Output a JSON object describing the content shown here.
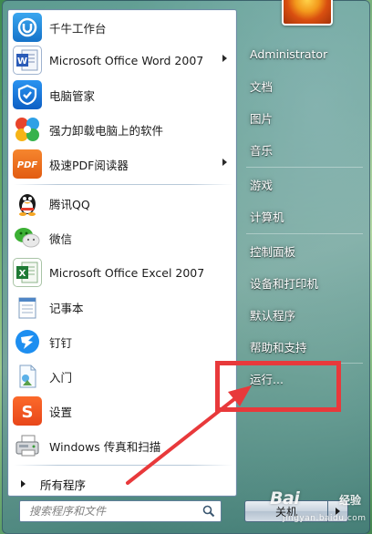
{
  "start_menu": {
    "programs": [
      {
        "id": "qianniu",
        "label": "千牛工作台",
        "icon": "qianniu-icon",
        "has_submenu": false
      },
      {
        "id": "word2007",
        "label": "Microsoft Office Word 2007",
        "icon": "word-icon",
        "has_submenu": true
      },
      {
        "id": "pcmanager",
        "label": "电脑管家",
        "icon": "shield-icon",
        "has_submenu": false
      },
      {
        "id": "uninstaller",
        "label": "强力卸载电脑上的软件",
        "icon": "clover-icon",
        "has_submenu": false
      },
      {
        "id": "pdfreader",
        "label": "极速PDF阅读器",
        "icon": "pdf-icon",
        "has_submenu": true
      },
      {
        "id": "qq",
        "label": "腾讯QQ",
        "icon": "penguin-icon",
        "has_submenu": false
      },
      {
        "id": "wechat",
        "label": "微信",
        "icon": "chat-bubbles-icon",
        "has_submenu": false
      },
      {
        "id": "excel2007",
        "label": "Microsoft Office Excel 2007",
        "icon": "excel-icon",
        "has_submenu": false
      },
      {
        "id": "notepad",
        "label": "记事本",
        "icon": "notepad-icon",
        "has_submenu": false
      },
      {
        "id": "dingtalk",
        "label": "钉钉",
        "icon": "dingtalk-icon",
        "has_submenu": false
      },
      {
        "id": "gettingstarted",
        "label": "入门",
        "icon": "document-icon",
        "has_submenu": false
      },
      {
        "id": "settings",
        "label": "设置",
        "icon": "sogou-icon",
        "has_submenu": false
      },
      {
        "id": "faxscan",
        "label": "Windows 传真和扫描",
        "icon": "fax-icon",
        "has_submenu": false
      }
    ],
    "all_programs_label": "所有程序",
    "search_placeholder": "搜索程序和文件",
    "right_items": [
      {
        "id": "administrator",
        "label": "Administrator"
      },
      {
        "id": "documents",
        "label": "文档"
      },
      {
        "id": "pictures",
        "label": "图片"
      },
      {
        "id": "music",
        "label": "音乐"
      },
      {
        "id": "games",
        "label": "游戏"
      },
      {
        "id": "computer",
        "label": "计算机"
      },
      {
        "id": "controlpanel",
        "label": "控制面板"
      },
      {
        "id": "devices",
        "label": "设备和打印机"
      },
      {
        "id": "defaultprograms",
        "label": "默认程序"
      },
      {
        "id": "help",
        "label": "帮助和支持"
      },
      {
        "id": "run",
        "label": "运行..."
      }
    ],
    "shutdown_label": "关机"
  },
  "watermark": {
    "brand": "Bai",
    "sub": "经验",
    "url": "jingyan.baidu.com"
  },
  "annotation_color": "#e8393b"
}
